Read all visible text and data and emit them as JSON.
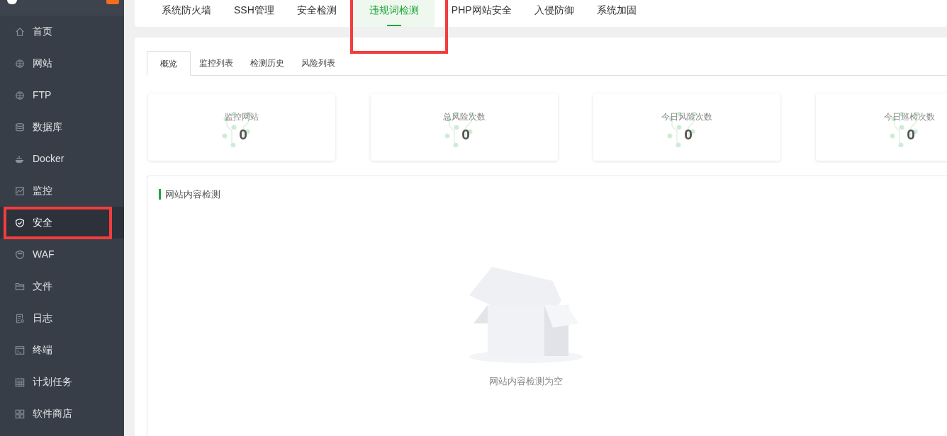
{
  "sidebar": {
    "items": [
      {
        "label": "首页",
        "selected": false
      },
      {
        "label": "网站",
        "selected": false
      },
      {
        "label": "FTP",
        "selected": false
      },
      {
        "label": "数据库",
        "selected": false
      },
      {
        "label": "Docker",
        "selected": false
      },
      {
        "label": "监控",
        "selected": false
      },
      {
        "label": "安全",
        "selected": true
      },
      {
        "label": "WAF",
        "selected": false
      },
      {
        "label": "文件",
        "selected": false
      },
      {
        "label": "日志",
        "selected": false
      },
      {
        "label": "终端",
        "selected": false
      },
      {
        "label": "计划任务",
        "selected": false
      },
      {
        "label": "软件商店",
        "selected": false
      }
    ]
  },
  "top_tabs": [
    {
      "label": "系统防火墙",
      "selected": false
    },
    {
      "label": "SSH管理",
      "selected": false
    },
    {
      "label": "安全检测",
      "selected": false
    },
    {
      "label": "违规词检测",
      "selected": true
    },
    {
      "label": "PHP网站安全",
      "selected": false
    },
    {
      "label": "入侵防御",
      "selected": false
    },
    {
      "label": "系统加固",
      "selected": false
    }
  ],
  "sub_tabs": [
    {
      "label": "概览",
      "selected": true
    },
    {
      "label": "监控列表",
      "selected": false
    },
    {
      "label": "检测历史",
      "selected": false
    },
    {
      "label": "风险列表",
      "selected": false
    }
  ],
  "stats": [
    {
      "label": "监控网站",
      "value": "0"
    },
    {
      "label": "总风险次数",
      "value": "0"
    },
    {
      "label": "今日风险次数",
      "value": "0"
    },
    {
      "label": "今日巡检次数",
      "value": "0"
    }
  ],
  "section": {
    "title": "网站内容检测",
    "empty_text": "网站内容检测为空"
  }
}
